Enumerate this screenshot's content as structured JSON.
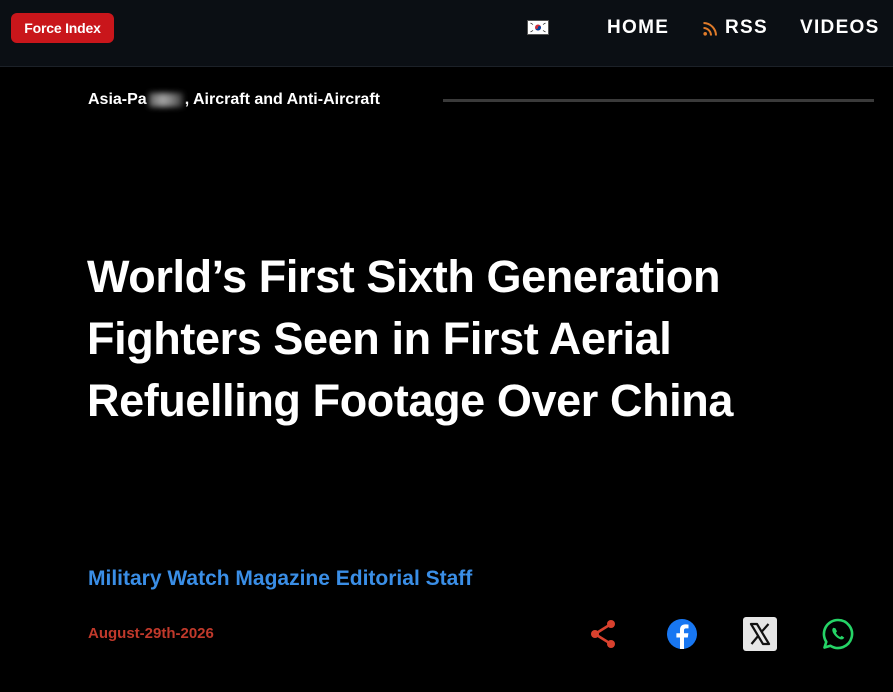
{
  "header": {
    "logo_label": "Force Index",
    "nav": {
      "home": "HOME",
      "rss": "RSS",
      "videos": "VIDEOS"
    }
  },
  "article": {
    "category_prefix": "Asia-Pa",
    "category_suffix": ", Aircraft and Anti-Aircraft",
    "title": "World’s First Sixth Generation Fighters Seen in First Aerial Refuelling Footage Over China",
    "author": "Military Watch Magazine Editorial Staff",
    "date": "August-29th-2026"
  },
  "share": {
    "icons": [
      "share-icon",
      "facebook-icon",
      "x-icon",
      "whatsapp-icon"
    ]
  },
  "colors": {
    "background": "#000000",
    "header_bg": "#0b0f14",
    "logo_red": "#c9161b",
    "author_blue": "#3a8ee6",
    "date_red": "#c0392b",
    "share_red": "#d9412e",
    "facebook_blue": "#1877f2",
    "whatsapp_green": "#25d366"
  }
}
